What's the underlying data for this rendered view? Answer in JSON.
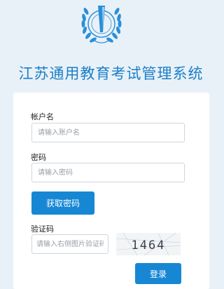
{
  "header": {
    "title": "江苏通用教育考试管理系统",
    "logo_icon": "laurel-emblem-icon"
  },
  "form": {
    "account": {
      "label": "帐户名",
      "placeholder": "请输入账户名",
      "value": ""
    },
    "password": {
      "label": "密码",
      "placeholder": "请输入密码",
      "value": ""
    },
    "get_password_label": "获取密码",
    "captcha": {
      "label": "验证码",
      "placeholder": "请输入右侧图片验证码",
      "value": "",
      "image_text": "1464"
    },
    "login_label": "登录"
  },
  "colors": {
    "accent": "#1787d4",
    "title": "#1b7fc7",
    "background": "#e9f1f8"
  }
}
